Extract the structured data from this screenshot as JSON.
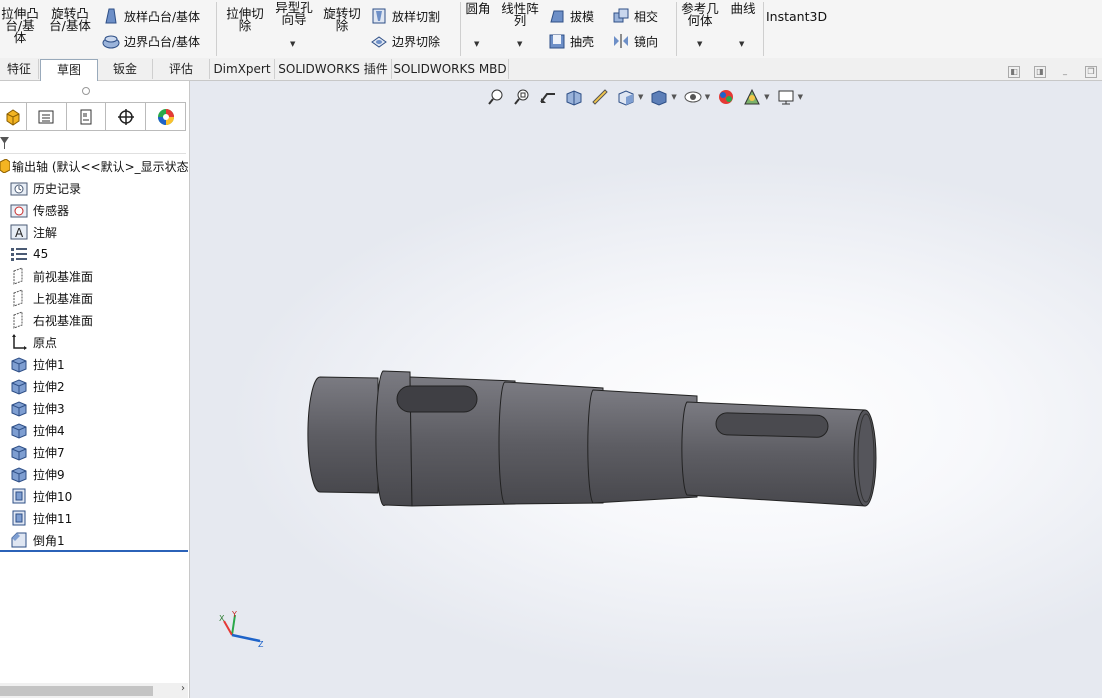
{
  "ribbon": {
    "extrude_boss": "拉伸凸台/基体",
    "revolve_boss": "旋转凸台/基体",
    "loft_boss": "放样凸台/基体",
    "boundary_boss": "边界凸台/基体",
    "extrude_cut": "拉伸切除",
    "hole_wizard": "异型孔向导",
    "revolve_cut": "旋转切除",
    "loft_cut": "放样切割",
    "boundary_cut": "边界切除",
    "fillet": "圆角",
    "linear_pattern": "线性阵列",
    "draft": "拔模",
    "intersect": "相交",
    "shell": "抽壳",
    "mirror": "镜向",
    "ref_geometry": "参考几何体",
    "curves": "曲线",
    "instant3d": "Instant3D"
  },
  "tabs": [
    "特征",
    "草图",
    "钣金",
    "评估",
    "DimXpert",
    "SOLIDWORKS 插件",
    "SOLIDWORKS MBD"
  ],
  "active_tab": "草图",
  "tree": {
    "root": "输出轴 (默认<<默认>_显示状态",
    "items": [
      {
        "label": "历史记录",
        "icon": "history-folder-icon"
      },
      {
        "label": "传感器",
        "icon": "sensor-icon"
      },
      {
        "label": "注解",
        "icon": "annotation-icon"
      },
      {
        "label": "45",
        "icon": "material-list-icon"
      },
      {
        "label": "前视基准面",
        "icon": "plane-icon"
      },
      {
        "label": "上视基准面",
        "icon": "plane-icon"
      },
      {
        "label": "右视基准面",
        "icon": "plane-icon"
      },
      {
        "label": "原点",
        "icon": "origin-icon"
      },
      {
        "label": "拉伸1",
        "icon": "extrude-feature-icon"
      },
      {
        "label": "拉伸2",
        "icon": "extrude-feature-icon"
      },
      {
        "label": "拉伸3",
        "icon": "extrude-feature-icon"
      },
      {
        "label": "拉伸4",
        "icon": "extrude-feature-icon"
      },
      {
        "label": "拉伸7",
        "icon": "extrude-feature-icon"
      },
      {
        "label": "拉伸9",
        "icon": "extrude-feature-icon"
      },
      {
        "label": "拉伸10",
        "icon": "cut-feature-icon"
      },
      {
        "label": "拉伸11",
        "icon": "cut-feature-icon"
      },
      {
        "label": "倒角1",
        "icon": "chamfer-icon"
      }
    ]
  },
  "triad": {
    "x": "X",
    "y": "Y",
    "z": "Z"
  },
  "colors": {
    "part": "#5d5d63",
    "accent": "#2b62b8"
  }
}
